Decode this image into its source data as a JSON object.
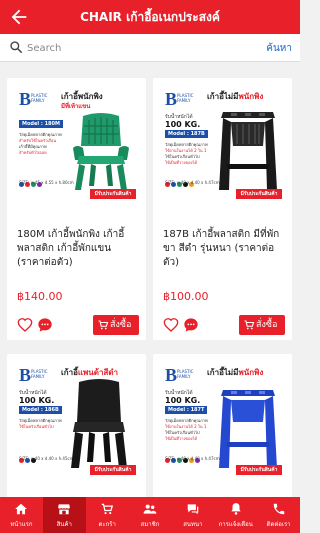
{
  "header": {
    "title": "CHAIR เก้าอี้อเนกประสงค์",
    "back_icon": "arrow-left-icon"
  },
  "search": {
    "placeholder": "Search",
    "button_label": "ค้นหา"
  },
  "colors": {
    "brand_red": "#e8202a",
    "brand_blue": "#1e4fa8"
  },
  "products": [
    {
      "name": "180M เก้าอี้พนักพิง เก้าอี้พลาสติก เก้าอี้พักแขน (ราคาต่อตัว)",
      "price": "฿140.00",
      "order_label": "สั่งซื้อ",
      "image": {
        "brand_letter": "B",
        "brand_text": "PLASTIC FAMILY",
        "tag": "เก้าอี้พนักพิง",
        "tag_sub": "มีที่เท้าแขน",
        "model": "Model : 180M",
        "features": [
          "วัสดุเม็ดพลาสติกคุณภาพ",
          "สำหรับใช้ในครัวเรือน",
          "เก้าอี้ที่มีคุณภาพ",
          "สำหรับทั่วไปเลย"
        ],
        "size": "SIZE: w.45 x d.55 x h.80cm",
        "ribbon": "มีรับประกันสินค้า"
      }
    },
    {
      "name": "187B เก้าอี้พลาสติก มีที่พักขา สีดำ รุ่นหนา (ราคาต่อตัว)",
      "price": "฿100.00",
      "order_label": "สั่งซื้อ",
      "image": {
        "brand_letter": "B",
        "brand_text": "PLASTIC FAMILY",
        "tag": "เก้าอี้ไม่มี",
        "tag_red": "พนักพิง",
        "capacity": "รับน้ำหนักได้",
        "capacity_value": "100 KG.",
        "model": "Model : 187B",
        "features": [
          "วัสดุเม็ดพลาสติกคุณภาพ",
          "ใช้งานในงานได้ 2 ใน 1",
          "ใช้ในครัวเรือนทั่วไป",
          "ใช้เป็นที่วางของได้"
        ],
        "size": "SIZE: w.40 x d.40 x h.47cm",
        "ribbon": "มีรับประกันสินค้า"
      }
    },
    {
      "image": {
        "brand_letter": "B",
        "brand_text": "PLASTIC FAMILY",
        "tag": "เก้าอี้",
        "tag_red": "แพนด้าสีดำ",
        "capacity": "รับน้ำหนักได้",
        "capacity_value": "100 KG.",
        "model": "Model : 186B",
        "features": [
          "วัสดุเม็ดพลาสติกคุณภาพ",
          "ใช้ในครัวเรือนทั่วไป"
        ],
        "size": "SIZE: w.40 x d.40 x h.45cm",
        "ribbon": "มีรับประกันสินค้า"
      }
    },
    {
      "image": {
        "brand_letter": "B",
        "brand_text": "PLASTIC FAMILY",
        "tag": "เก้าอี้ไม่มี",
        "tag_red": "พนักพิง",
        "capacity": "รับน้ำหนักได้",
        "capacity_value": "100 KG.",
        "model": "Model : 187T",
        "features": [
          "วัสดุเม็ดพลาสติกคุณภาพ",
          "ใช้งานในงานได้ 2 ใน 1",
          "ใช้ในครัวเรือนทั่วไป",
          "ใช้เป็นที่วางของได้"
        ],
        "size": "SIZE: w.40 x d.40 x h.47cm",
        "ribbon": "มีรับประกันสินค้า"
      }
    }
  ],
  "bottom_nav": [
    {
      "label": "หน้าแรก",
      "icon": "home-icon"
    },
    {
      "label": "สินค้า",
      "icon": "store-icon",
      "active": true
    },
    {
      "label": "ตะกร้า",
      "icon": "cart-icon"
    },
    {
      "label": "สมาชิก",
      "icon": "members-icon"
    },
    {
      "label": "สนทนา",
      "icon": "chat-icon"
    },
    {
      "label": "การแจ้งเตือน",
      "icon": "bell-icon"
    },
    {
      "label": "ติดต่อเรา",
      "icon": "phone-icon"
    }
  ]
}
